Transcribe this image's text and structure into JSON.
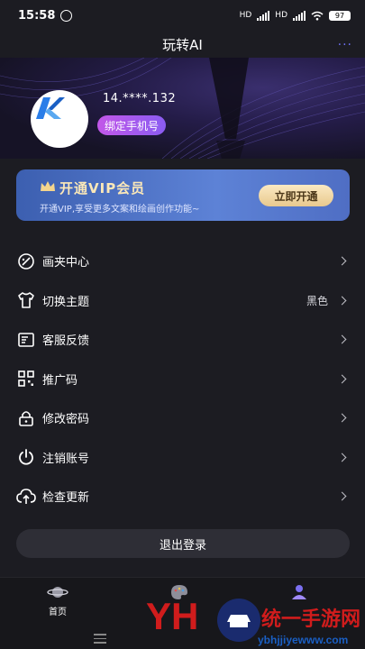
{
  "status_bar": {
    "time": "15:58",
    "network": "HD",
    "network2": "HD",
    "battery": "97"
  },
  "header": {
    "title": "玩转AI",
    "more_label": "···"
  },
  "profile": {
    "phone": "14.****.132",
    "bind_label": "绑定手机号"
  },
  "vip": {
    "title": "开通VIP会员",
    "subtitle": "开通VIP,享受更多文案和绘画创作功能~",
    "button": "立即开通"
  },
  "menu": [
    {
      "label": "画夹中心",
      "icon": "palette-icon",
      "value": ""
    },
    {
      "label": "切换主题",
      "icon": "tshirt-icon",
      "value": "黑色"
    },
    {
      "label": "客服反馈",
      "icon": "feedback-icon",
      "value": ""
    },
    {
      "label": "推广码",
      "icon": "qrcode-icon",
      "value": ""
    },
    {
      "label": "修改密码",
      "icon": "lock-icon",
      "value": ""
    },
    {
      "label": "注销账号",
      "icon": "power-icon",
      "value": ""
    },
    {
      "label": "检查更新",
      "icon": "cloud-upload-icon",
      "value": ""
    }
  ],
  "logout_label": "退出登录",
  "bottom_nav": {
    "home": "首页"
  },
  "watermark": {
    "brand": "统一手游网",
    "url": "ybhjjiyewww.com"
  },
  "colors": {
    "accent": "#6c6ff0",
    "bind_gradient_start": "#c257e8",
    "vip_gold": "#fbe8b8"
  }
}
